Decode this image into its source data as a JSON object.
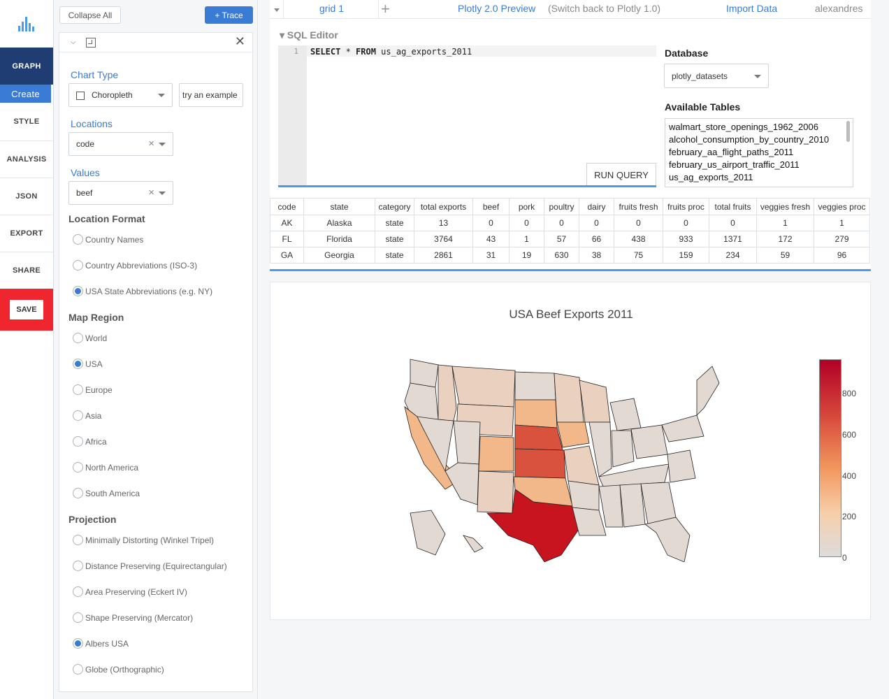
{
  "nav": {
    "graph": "GRAPH",
    "create": "Create",
    "style": "STYLE",
    "analysis": "ANALYSIS",
    "json": "JSON",
    "export": "EXPORT",
    "share": "SHARE",
    "save": "SAVE"
  },
  "panel": {
    "collapse_all": "Collapse All",
    "add_trace": "+ Trace",
    "chart_type_label": "Chart Type",
    "chart_type_value": "Choropleth",
    "try_example": "try an example",
    "locations_label": "Locations",
    "locations_value": "code",
    "values_label": "Values",
    "values_value": "beef",
    "location_format_label": "Location Format",
    "location_format_options": [
      "Country Names",
      "Country Abbreviations (ISO-3)",
      "USA State Abbreviations (e.g. NY)"
    ],
    "location_format_selected": 2,
    "map_region_label": "Map Region",
    "map_region_options": [
      "World",
      "USA",
      "Europe",
      "Asia",
      "Africa",
      "North America",
      "South America"
    ],
    "map_region_selected": 1,
    "projection_label": "Projection",
    "projection_options": [
      "Minimally Distorting (Winkel Tripel)",
      "Distance Preserving (Equirectangular)",
      "Area Preserving (Eckert IV)",
      "Shape Preserving (Mercator)",
      "Albers USA",
      "Globe (Orthographic)"
    ],
    "projection_selected": 4
  },
  "tabs": {
    "grid": "grid 1",
    "add": "+",
    "preview": "Plotly 2.0 Preview",
    "switch_back": "(Switch back to Plotly 1.0)",
    "import": "Import Data",
    "user": "alexandres"
  },
  "sql": {
    "title": "SQL Editor",
    "line_no": "1",
    "kw_select": "SELECT",
    "star": " * ",
    "kw_from": "FROM",
    "table": " us_ag_exports_2011",
    "run": "RUN QUERY",
    "db_label": "Database",
    "db_value": "plotly_datasets",
    "tables_label": "Available Tables",
    "tables": [
      "walmart_store_openings_1962_2006",
      "alcohol_consumption_by_country_2010",
      "february_aa_flight_paths_2011",
      "february_us_airport_traffic_2011",
      "us_ag_exports_2011"
    ]
  },
  "grid": {
    "columns": [
      "code",
      "state",
      "category",
      "total exports",
      "beef",
      "pork",
      "poultry",
      "dairy",
      "fruits fresh",
      "fruits proc",
      "total fruits",
      "veggies fresh",
      "veggies proc"
    ],
    "rows": [
      [
        "AK",
        "Alaska",
        "state",
        "13",
        "0",
        "0",
        "0",
        "0",
        "0",
        "0",
        "0",
        "1",
        "1"
      ],
      [
        "FL",
        "Florida",
        "state",
        "3764",
        "43",
        "1",
        "57",
        "66",
        "438",
        "933",
        "1371",
        "172",
        "279"
      ],
      [
        "GA",
        "Georgia",
        "state",
        "2861",
        "31",
        "19",
        "630",
        "38",
        "75",
        "159",
        "234",
        "59",
        "96"
      ]
    ]
  },
  "chart_data": {
    "type": "choropleth",
    "title": "USA Beef Exports 2011",
    "locations": [
      "AK",
      "FL",
      "GA"
    ],
    "values": [
      0,
      43,
      31
    ],
    "colorbar": {
      "range": [
        0,
        960
      ],
      "ticks": [
        "800",
        "600",
        "400",
        "200",
        "0"
      ]
    },
    "colorscale": [
      "#dcdcdc",
      "#f7cfab",
      "#f2975d",
      "#d6473b",
      "#b10026"
    ]
  },
  "colors": {
    "accent": "#3a7bd5",
    "nav_dark": "#1f3d73",
    "save_red": "#f0262e"
  }
}
